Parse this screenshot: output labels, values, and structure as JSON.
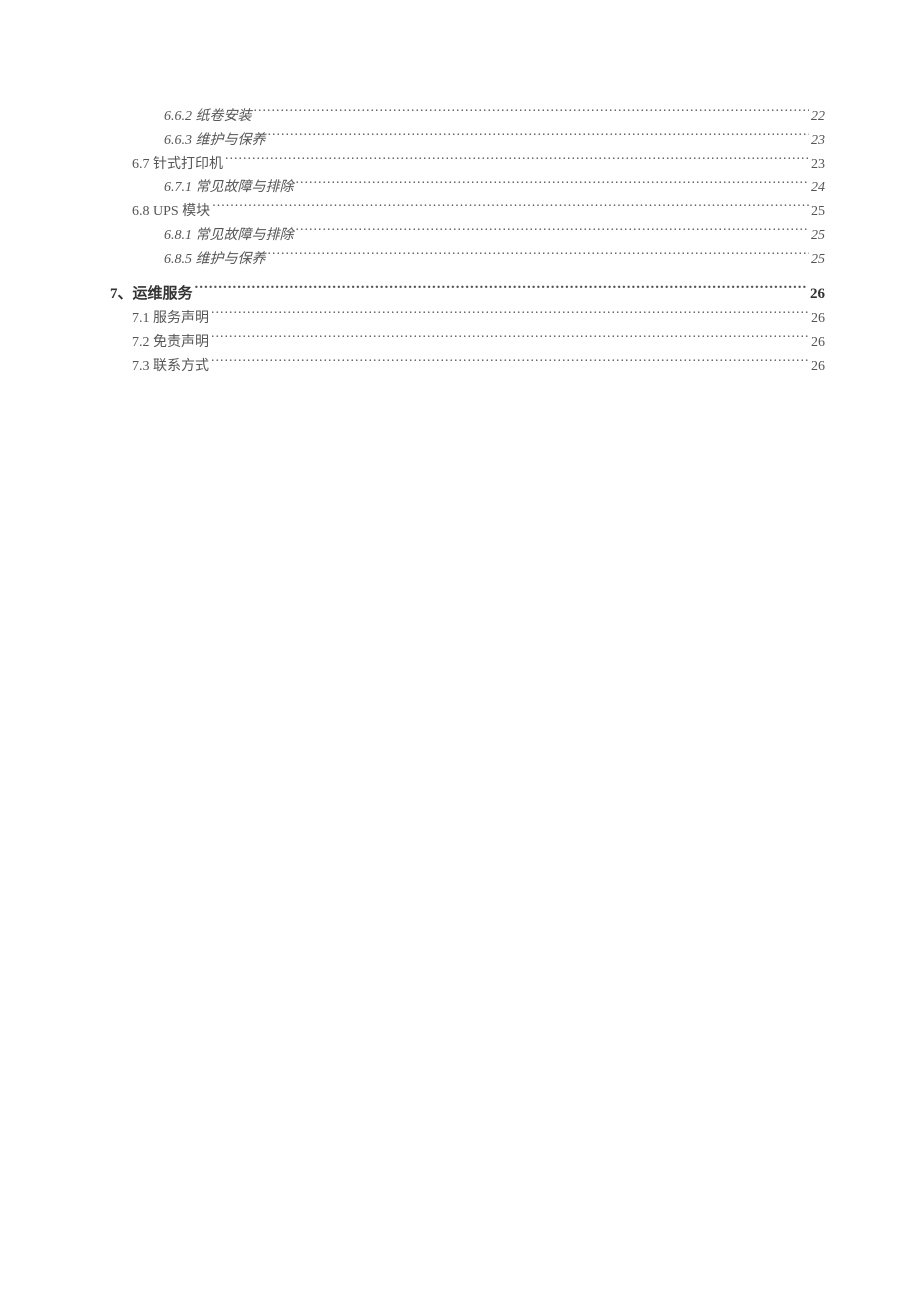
{
  "toc": [
    {
      "level": 3,
      "label": "6.6.2 纸卷安装",
      "page": "22"
    },
    {
      "level": 3,
      "label": "6.6.3 维护与保养",
      "page": "23"
    },
    {
      "level": 2,
      "label": "6.7 针式打印机",
      "page": "23"
    },
    {
      "level": 3,
      "label": "6.7.1 常见故障与排除",
      "page": "24"
    },
    {
      "level": 2,
      "label": "6.8  UPS 模块",
      "page": "25"
    },
    {
      "level": 3,
      "label": "6.8.1  常见故障与排除",
      "page": "25"
    },
    {
      "level": 3,
      "label": "6.8.5 维护与保养",
      "page": "25"
    },
    {
      "level": 1,
      "label": "7、运维服务",
      "page": "26"
    },
    {
      "level": 2,
      "label": "7.1 服务声明",
      "page": "26"
    },
    {
      "level": 2,
      "label": "7.2 免责声明",
      "page": "26"
    },
    {
      "level": 2,
      "label": "7.3 联系方式",
      "page": "26"
    }
  ]
}
